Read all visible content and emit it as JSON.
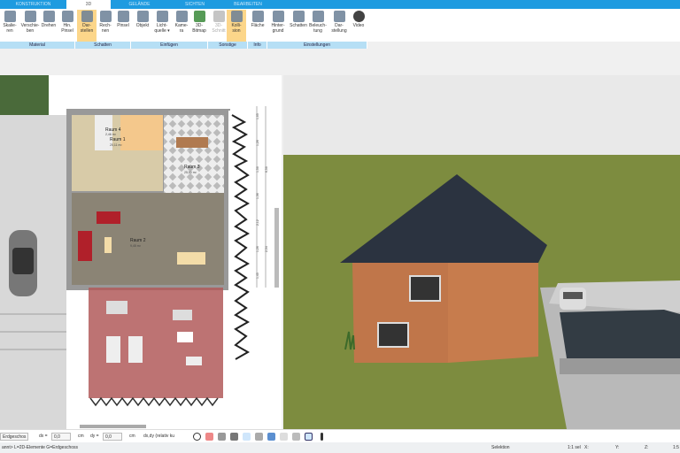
{
  "tabs": [
    "KONSTRUKTION",
    "3D",
    "GELÄNDE",
    "SICHTEN",
    "BEARBEITEN"
  ],
  "active_tab": "3D",
  "ribbon": [
    {
      "l1": "Skalie-",
      "l2": "ren",
      "icon": "scale-icon"
    },
    {
      "l1": "Verschie-",
      "l2": "ben",
      "icon": "move-icon"
    },
    {
      "l1": "Drehen",
      "l2": "",
      "icon": "rotate-icon"
    },
    {
      "l1": "Hin.",
      "l2": "Pinsel",
      "icon": "brush-icon"
    },
    {
      "l1": "Dar-",
      "l2": "stellen",
      "icon": "render-icon",
      "active": true
    },
    {
      "l1": "Rech-",
      "l2": "nen",
      "icon": "calculate-icon"
    },
    {
      "l1": "Pinsel",
      "l2": "",
      "icon": "paint-icon"
    },
    {
      "l1": "Objekt",
      "l2": "",
      "icon": "chair-icon"
    },
    {
      "l1": "Licht-",
      "l2": "quelle ▾",
      "icon": "lightbulb-icon"
    },
    {
      "l1": "Kame-",
      "l2": "ra",
      "icon": "camera-icon"
    },
    {
      "l1": "3D-",
      "l2": "Bitmap",
      "icon": "tree-icon"
    },
    {
      "l1": "3D-",
      "l2": "Schnitt",
      "icon": "section-icon",
      "disabled": true
    },
    {
      "l1": "Kolli-",
      "l2": "sion",
      "icon": "collision-icon",
      "active": true
    },
    {
      "l1": "Fläche",
      "l2": "",
      "icon": "area-icon"
    },
    {
      "l1": "Hinter-",
      "l2": "grund",
      "icon": "background-icon"
    },
    {
      "l1": "Schatten",
      "l2": "",
      "icon": "shadow-icon"
    },
    {
      "l1": "Beleuch-",
      "l2": "tung",
      "icon": "lighting-icon"
    },
    {
      "l1": "Dar-",
      "l2": "stellung",
      "icon": "display-icon"
    },
    {
      "l1": "Video",
      "l2": "",
      "icon": "video-icon"
    }
  ],
  "groups": [
    "Material",
    "Schatten",
    "Einfügen",
    "Sonstige",
    "Info",
    "Einstellungen"
  ],
  "plan": {
    "rooms": [
      {
        "name": "Raum 4",
        "area": "2,46 m²"
      },
      {
        "name": "Raum 1",
        "area": "20,11 m²"
      },
      {
        "name": "Raum 3",
        "area": "25,50 m²"
      },
      {
        "name": "Raum 2",
        "area": "9,45 m²"
      }
    ],
    "dims": [
      "1,05",
      "1,26",
      "1,50",
      "1,36",
      "2,12",
      "1,26",
      "1,45",
      "6,50",
      "2,54"
    ]
  },
  "toolbar": {
    "floor": "Erdgeschos",
    "dx_label": "dx =",
    "dx": "0,0",
    "unit": "cm",
    "dy_label": "dy =",
    "dy": "0,0",
    "mode": "dx,dy (relativ ku"
  },
  "status": {
    "left": "annt> L=2D-Elemente G=Erdgeschoss",
    "mode": "Selektion",
    "scale": "1:1 sel",
    "x": "X:",
    "y": "Y:",
    "z": "Z:",
    "ratio": "1:5"
  },
  "colors": {
    "accent": "#1e9be0",
    "active": "#fcd68a",
    "grass": "#7d8c3f",
    "roof": "#2b3340",
    "wall": "#c0764a"
  }
}
